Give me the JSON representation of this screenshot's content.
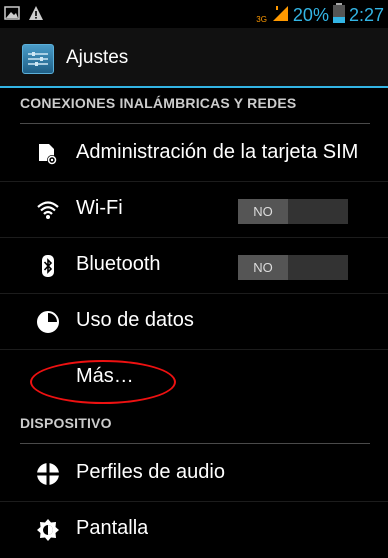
{
  "status_bar": {
    "network": "3G",
    "battery": "20%",
    "time": "2:27"
  },
  "header": {
    "title": "Ajustes",
    "icon": "settings-sliders-icon"
  },
  "sections": [
    {
      "title": "CONEXIONES INALÁMBRICAS Y REDES"
    },
    {
      "title": "DISPOSITIVO"
    }
  ],
  "items": [
    {
      "label": "Administración de la tarjeta SIM",
      "icon": "sim-settings-icon"
    },
    {
      "label": "Wi-Fi",
      "icon": "wifi-icon",
      "toggle": "NO"
    },
    {
      "label": "Bluetooth",
      "icon": "bluetooth-icon",
      "toggle": "NO"
    },
    {
      "label": "Uso de datos",
      "icon": "data-usage-icon"
    },
    {
      "label": "Más…"
    },
    {
      "label": "Perfiles de audio",
      "icon": "audio-profiles-icon"
    },
    {
      "label": "Pantalla",
      "icon": "display-icon"
    }
  ],
  "colors": {
    "accent": "#33b5e5",
    "highlight_circle": "#e11111"
  }
}
